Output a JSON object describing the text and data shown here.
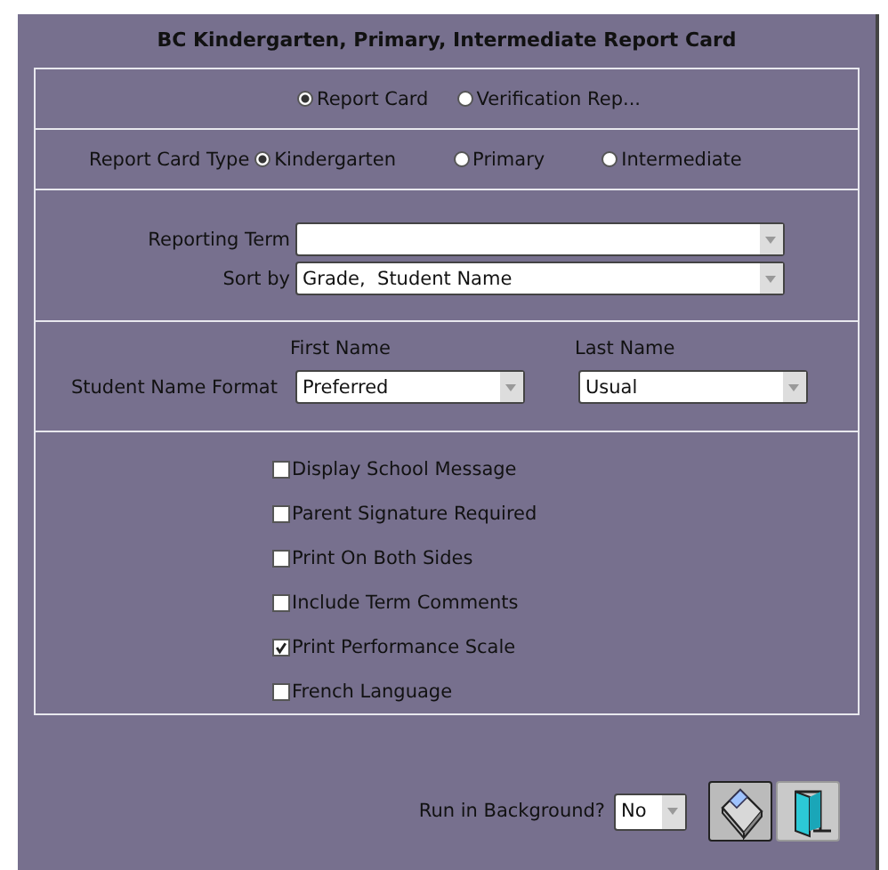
{
  "title": "BC Kindergarten, Primary, Intermediate Report Card",
  "report_options": [
    {
      "label": "Report Card",
      "selected": true
    },
    {
      "label": "Verification Rep...",
      "selected": false
    }
  ],
  "report_card_type": {
    "label": "Report Card Type",
    "options": [
      {
        "label": "Kindergarten",
        "selected": true
      },
      {
        "label": "Primary",
        "selected": false
      },
      {
        "label": "Intermediate",
        "selected": false
      }
    ]
  },
  "reporting_term": {
    "label": "Reporting Term"
  },
  "sort_by": {
    "label": "Sort by",
    "value": "Grade,  Student Name"
  },
  "student_name_format": {
    "label": "Student Name Format",
    "first_name": {
      "label": "First Name",
      "value": "Preferred"
    },
    "last_name": {
      "label": "Last Name",
      "value": "Usual"
    }
  },
  "options": [
    {
      "label": "Display School Message",
      "checked": false
    },
    {
      "label": "Parent Signature Required",
      "checked": false
    },
    {
      "label": "Print On Both Sides",
      "checked": false
    },
    {
      "label": "Include Term Comments",
      "checked": false
    },
    {
      "label": "Print Performance Scale",
      "checked": true
    },
    {
      "label": "French Language",
      "checked": false
    }
  ],
  "run_in_background": {
    "label": "Run in Background?",
    "value": "No"
  }
}
